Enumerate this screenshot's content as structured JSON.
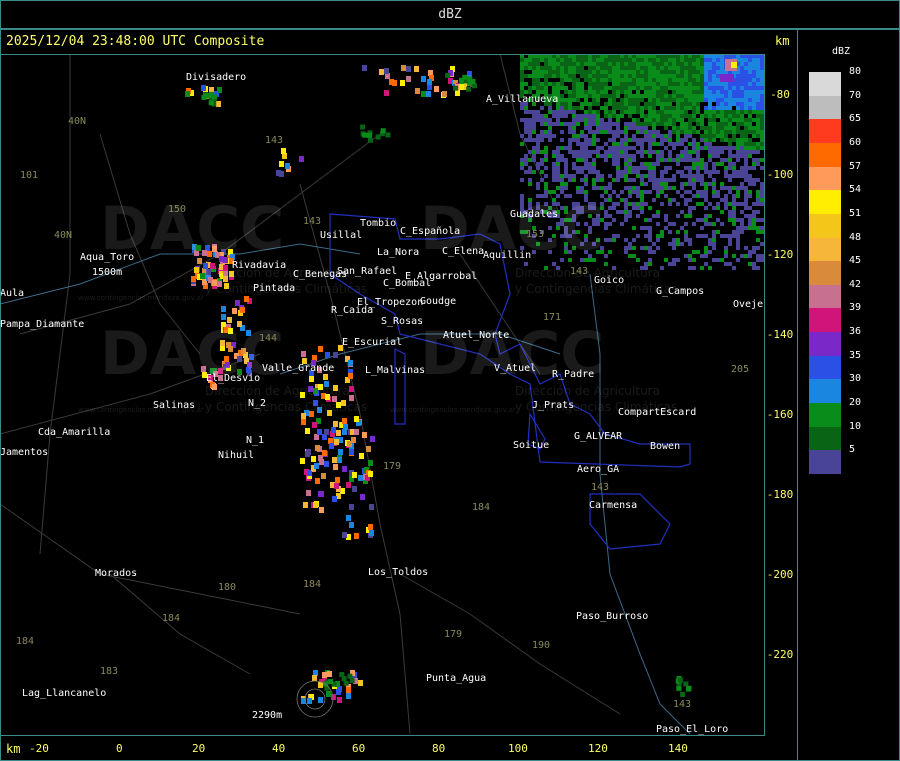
{
  "window": {
    "title": "dBZ"
  },
  "header": {
    "timestamp": "2025/12/04 23:48:00 UTC Composite",
    "unit_top": "km",
    "unit_bottom": "km"
  },
  "axes": {
    "y_ticks": [
      "-80",
      "-100",
      "-120",
      "-140",
      "-160",
      "-180",
      "-200",
      "-220"
    ],
    "x_ticks": [
      "-20",
      "0",
      "20",
      "40",
      "60",
      "80",
      "100",
      "120",
      "140"
    ]
  },
  "legend": {
    "title": "dBZ",
    "entries": [
      {
        "label": "80",
        "color": "#d9d9d9"
      },
      {
        "label": "70",
        "color": "#bdbdbd"
      },
      {
        "label": "65",
        "color": "#ff3b1f"
      },
      {
        "label": "60",
        "color": "#ff6a00"
      },
      {
        "label": "57",
        "color": "#ff9a5a"
      },
      {
        "label": "54",
        "color": "#ffee00"
      },
      {
        "label": "51",
        "color": "#f5c61a"
      },
      {
        "label": "48",
        "color": "#f5b63a"
      },
      {
        "label": "45",
        "color": "#d98a3a"
      },
      {
        "label": "42",
        "color": "#c87090"
      },
      {
        "label": "39",
        "color": "#d0147a"
      },
      {
        "label": "36",
        "color": "#7a28c8"
      },
      {
        "label": "35",
        "color": "#2a50e6"
      },
      {
        "label": "30",
        "color": "#1a86e0"
      },
      {
        "label": "20",
        "color": "#0a8c1a"
      },
      {
        "label": "10",
        "color": "#0a6416"
      },
      {
        "label": "5",
        "color": "#4a4496"
      }
    ]
  },
  "places": [
    "Divisadero",
    "A_Villanueva",
    "Tombio",
    "Usillal",
    "C_Española",
    "La_Nora",
    "C_Elena",
    "Aquillin",
    "Aqua_Toro",
    "Rivadavia",
    "San_Rafael",
    "C_Benegas",
    "C_Bombal",
    "E_Algarrobal",
    "Guadales",
    "Goico",
    "G_Campos",
    "Ovejeria",
    "Pampa_Diamante",
    "Pintada",
    "El_Tropezon",
    "Goudge",
    "R_Caida",
    "S_Rosas",
    "Atuel_Norte",
    "E_Escurial",
    "Valle_Grande",
    "L_Malvinas",
    "V_Atuel",
    "R_Padre",
    "El_Desvio",
    "Salinas",
    "N_2",
    "J_Prats",
    "CompartEscard",
    "Cda_Amarilla",
    "N_1",
    "Nihuil",
    "Soitue",
    "G_ALVEAR",
    "Bowen",
    "Aero_GA",
    "Carmensa",
    "Morados",
    "Los_Toldos",
    "Paso_Burroso",
    "Punta_Agua",
    "Lag_Llancanelo",
    "Paso_El_Loro",
    "Jamentos",
    "Aula",
    "Aqua_Toro",
    "2290m",
    "1500m"
  ],
  "routes": [
    "40N",
    "101",
    "40N",
    "143",
    "150",
    "143",
    "144",
    "171",
    "153",
    "179",
    "184",
    "180",
    "184",
    "179",
    "190",
    "184",
    "183",
    "184",
    "143",
    "205",
    "143",
    "143"
  ],
  "watermark": {
    "brand": "DACC",
    "line1": "Dirección de Agricultura",
    "line2": "y Contingencias Climáticas",
    "url": "www.contingencias.mendoza.gov.ar"
  }
}
